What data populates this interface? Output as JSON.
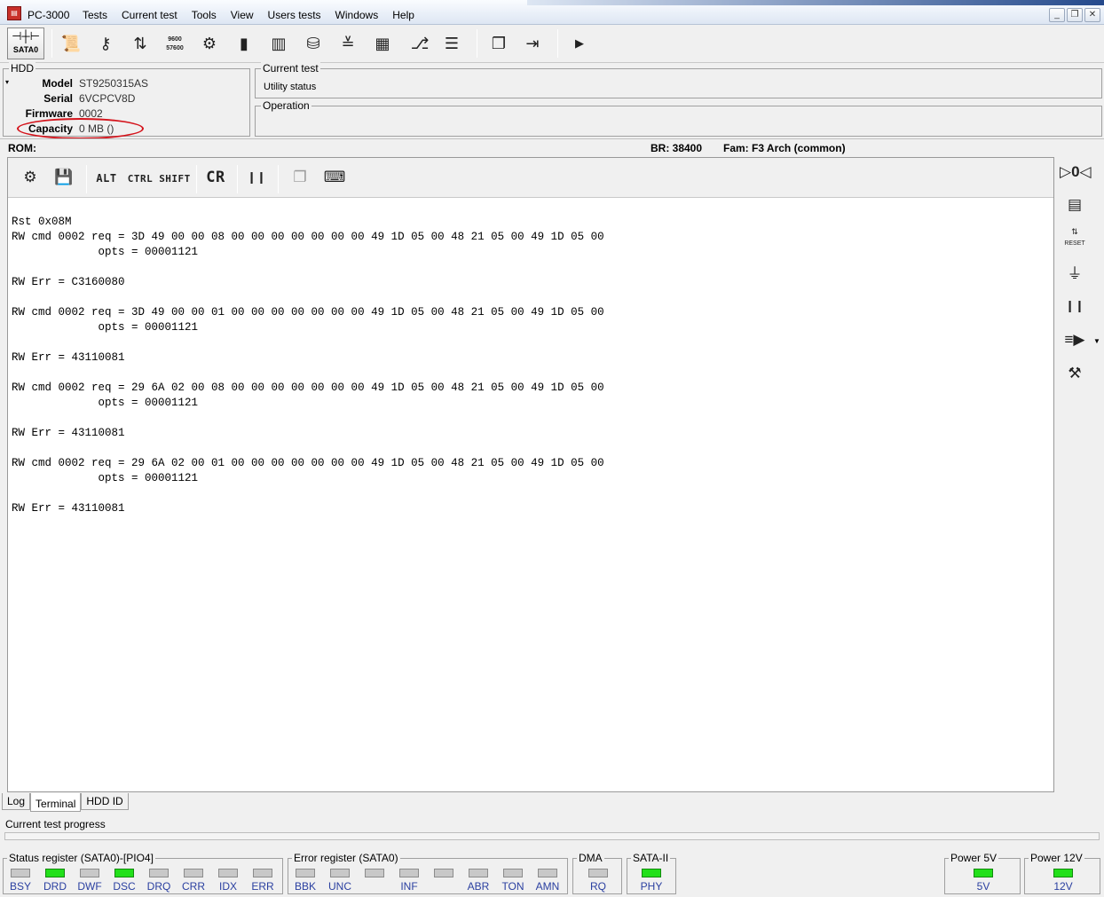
{
  "window": {
    "title": "PC-3000",
    "app_icon": "pc3000-icon"
  },
  "menu": [
    "Tests",
    "Current test",
    "Tools",
    "View",
    "Users tests",
    "Windows",
    "Help"
  ],
  "toolbar": {
    "sata_label": "SATA0",
    "text_9600": "9600",
    "text_57600": "57600"
  },
  "hdd": {
    "title": "HDD",
    "rows": [
      {
        "key": "Model",
        "value": "ST9250315AS"
      },
      {
        "key": "Serial",
        "value": "6VCPCV8D"
      },
      {
        "key": "Firmware",
        "value": "0002"
      },
      {
        "key": "Capacity",
        "value": "0 MB ()"
      }
    ]
  },
  "current_test": {
    "title": "Current test",
    "value": "Utility status"
  },
  "operation": {
    "title": "Operation"
  },
  "infobar": {
    "rom": "ROM:",
    "br": "BR: 38400",
    "fam": "Fam: F3 Arch (common)"
  },
  "terminal_toolbar": {
    "alt": "ALT",
    "ctrl": "CTRL",
    "shift": "SHIFT",
    "cr": "CR"
  },
  "terminal": {
    "lines": [
      "Rst 0x08M",
      "RW cmd 0002 req = 3D 49 00 00 08 00 00 00 00 00 00 00 49 1D 05 00 48 21 05 00 49 1D 05 00",
      "             opts = 00001121",
      "",
      "RW Err = C3160080",
      "",
      "RW cmd 0002 req = 3D 49 00 00 01 00 00 00 00 00 00 00 49 1D 05 00 48 21 05 00 49 1D 05 00",
      "             opts = 00001121",
      "",
      "RW Err = 43110081",
      "",
      "RW cmd 0002 req = 29 6A 02 00 08 00 00 00 00 00 00 00 49 1D 05 00 48 21 05 00 49 1D 05 00",
      "             opts = 00001121",
      "",
      "RW Err = 43110081",
      "",
      "RW cmd 0002 req = 29 6A 02 00 01 00 00 00 00 00 00 00 49 1D 05 00 48 21 05 00 49 1D 05 00",
      "             opts = 00001121",
      "",
      "RW Err = 43110081"
    ]
  },
  "right_toolbar": {
    "reset_label": "RESET"
  },
  "tabs": [
    "Log",
    "Terminal",
    "HDD ID"
  ],
  "active_tab": "Terminal",
  "progress": {
    "label": "Current test progress",
    "value": 0
  },
  "status_register": {
    "title": "Status register (SATA0)-[PIO4]",
    "leds": [
      {
        "label": "BSY",
        "on": false
      },
      {
        "label": "DRD",
        "on": true
      },
      {
        "label": "DWF",
        "on": false
      },
      {
        "label": "DSC",
        "on": true
      },
      {
        "label": "DRQ",
        "on": false
      },
      {
        "label": "CRR",
        "on": false
      },
      {
        "label": "IDX",
        "on": false
      },
      {
        "label": "ERR",
        "on": false
      }
    ]
  },
  "error_register": {
    "title": "Error register (SATA0)",
    "leds": [
      {
        "label": "BBK",
        "on": false
      },
      {
        "label": "UNC",
        "on": false
      },
      {
        "label": "",
        "on": false
      },
      {
        "label": "INF",
        "on": false
      },
      {
        "label": "",
        "on": false
      },
      {
        "label": "ABR",
        "on": false
      },
      {
        "label": "TON",
        "on": false
      },
      {
        "label": "AMN",
        "on": false
      }
    ]
  },
  "dma": {
    "title": "DMA",
    "leds": [
      {
        "label": "RQ",
        "on": false
      }
    ]
  },
  "sata2": {
    "title": "SATA-II",
    "leds": [
      {
        "label": "PHY",
        "on": true
      }
    ]
  },
  "power5": {
    "title": "Power 5V",
    "leds": [
      {
        "label": "5V",
        "on": true
      }
    ]
  },
  "power12": {
    "title": "Power 12V",
    "leds": [
      {
        "label": "12V",
        "on": true
      }
    ]
  }
}
